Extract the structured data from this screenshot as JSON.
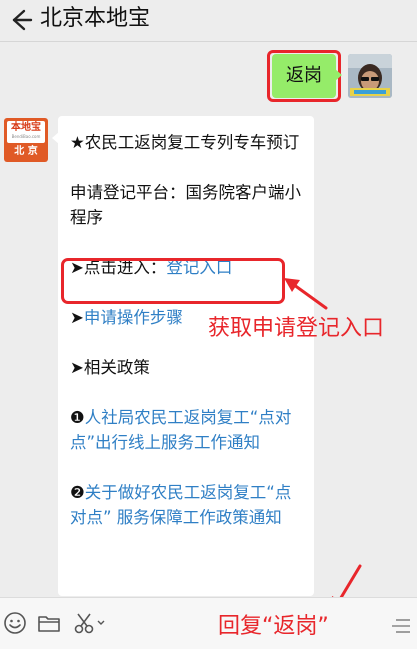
{
  "header": {
    "title": "北京本地宝"
  },
  "outgoing_message": {
    "text": "返岗"
  },
  "bot": {
    "logo_text": "本地宝",
    "logo_sub": "BendiBao.com",
    "logo_city": "北 京"
  },
  "incoming_message": {
    "line1": "★农民工返岗复工专列专车预订",
    "line2": "申请登记平台：国务院客户端小程序",
    "line3_prefix": "➤点击进入：",
    "line3_link": "登记入口",
    "line4_prefix": "➤",
    "line4_link": "申请操作步骤",
    "line5": "➤相关政策",
    "line6_prefix": "❶",
    "line6_link": "人社局农民工返岗复工“点对点”出行线上服务工作通知",
    "line7_prefix": "❷",
    "line7_link": "关于做好农民工返岗复工“点对点” 服务保障工作政策通知"
  },
  "annotations": {
    "get_entry": "获取申请登记入口",
    "reply_hint": "回复“返岗”"
  },
  "colors": {
    "accent_red": "#e8262b",
    "bubble_green": "#95ec69",
    "link_blue": "#2f7fc5"
  },
  "icons": [
    "back-arrow-icon",
    "emoji-icon",
    "folder-icon",
    "scissors-icon",
    "menu-icon"
  ]
}
